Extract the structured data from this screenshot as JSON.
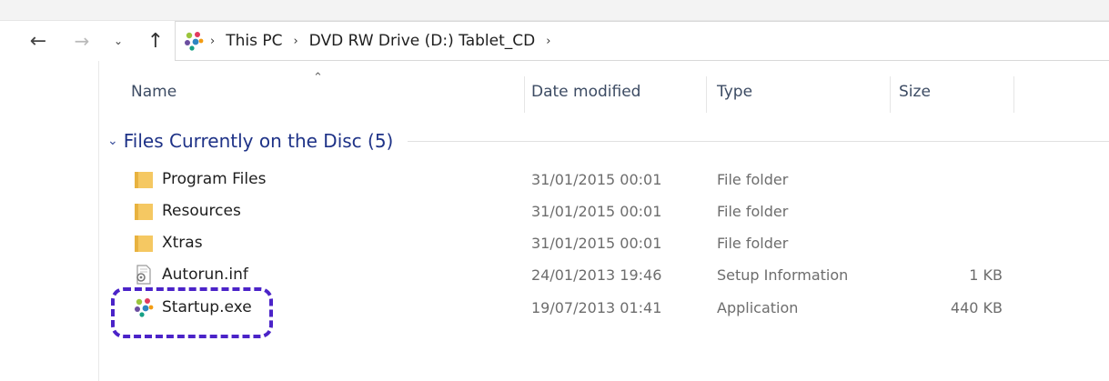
{
  "breadcrumb": {
    "items": [
      "This PC",
      "DVD RW Drive (D:) Tablet_CD"
    ]
  },
  "columns": {
    "name": "Name",
    "date_modified": "Date modified",
    "type": "Type",
    "size": "Size"
  },
  "group": {
    "title": "Files Currently on the Disc (5)"
  },
  "files": [
    {
      "name": "Program Files",
      "date": "31/01/2015 00:01",
      "type": "File folder",
      "size": "",
      "icon": "folder-icon"
    },
    {
      "name": "Resources",
      "date": "31/01/2015 00:01",
      "type": "File folder",
      "size": "",
      "icon": "folder-icon"
    },
    {
      "name": "Xtras",
      "date": "31/01/2015 00:01",
      "type": "File folder",
      "size": "",
      "icon": "folder-icon"
    },
    {
      "name": "Autorun.inf",
      "date": "24/01/2013 19:46",
      "type": "Setup Information",
      "size": "1 KB",
      "icon": "setup-info-icon"
    },
    {
      "name": "Startup.exe",
      "date": "19/07/2013 01:41",
      "type": "Application",
      "size": "440 KB",
      "icon": "application-icon"
    }
  ],
  "colors": {
    "group_title": "#1e3287",
    "highlight": "#4b23c8",
    "folder": "#f5c862"
  }
}
